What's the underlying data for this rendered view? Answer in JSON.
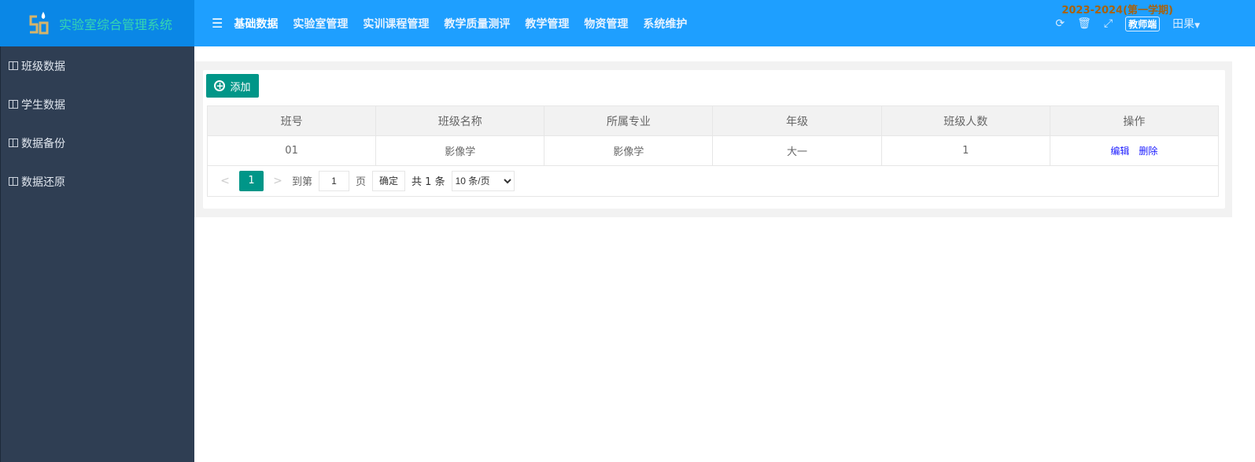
{
  "app": {
    "title": "实验室综合管理系统"
  },
  "topnav": {
    "items": [
      "基础数据",
      "实验室管理",
      "实训课程管理",
      "教学质量测评",
      "教学管理",
      "物资管理",
      "系统维护"
    ],
    "active": 0
  },
  "header": {
    "term": "2023-2024(第一学期)",
    "role_badge": "教师端",
    "user": "田果",
    "icons": [
      "refresh-icon",
      "trash-icon",
      "fullscreen-icon"
    ]
  },
  "sidebar": {
    "items": [
      {
        "label": "班级数据"
      },
      {
        "label": "学生数据"
      },
      {
        "label": "数据备份"
      },
      {
        "label": "数据还原"
      }
    ]
  },
  "toolbar": {
    "add_label": "添加"
  },
  "table": {
    "headers": [
      "班号",
      "班级名称",
      "所属专业",
      "年级",
      "班级人数",
      "操作"
    ],
    "rows": [
      {
        "id": "01",
        "name": "影像学",
        "major": "影像学",
        "grade": "大一",
        "count": "1",
        "actions": [
          "编辑",
          "删除"
        ]
      }
    ]
  },
  "pager": {
    "current": "1",
    "goto_label": "到第",
    "goto_value": "1",
    "page_label": "页",
    "confirm": "确定",
    "total": "共 1 条",
    "page_size": "10 条/页"
  },
  "colors": {
    "primary": "#009688",
    "topbar": "#1e9fff",
    "sidebar": "#2f3e53"
  }
}
